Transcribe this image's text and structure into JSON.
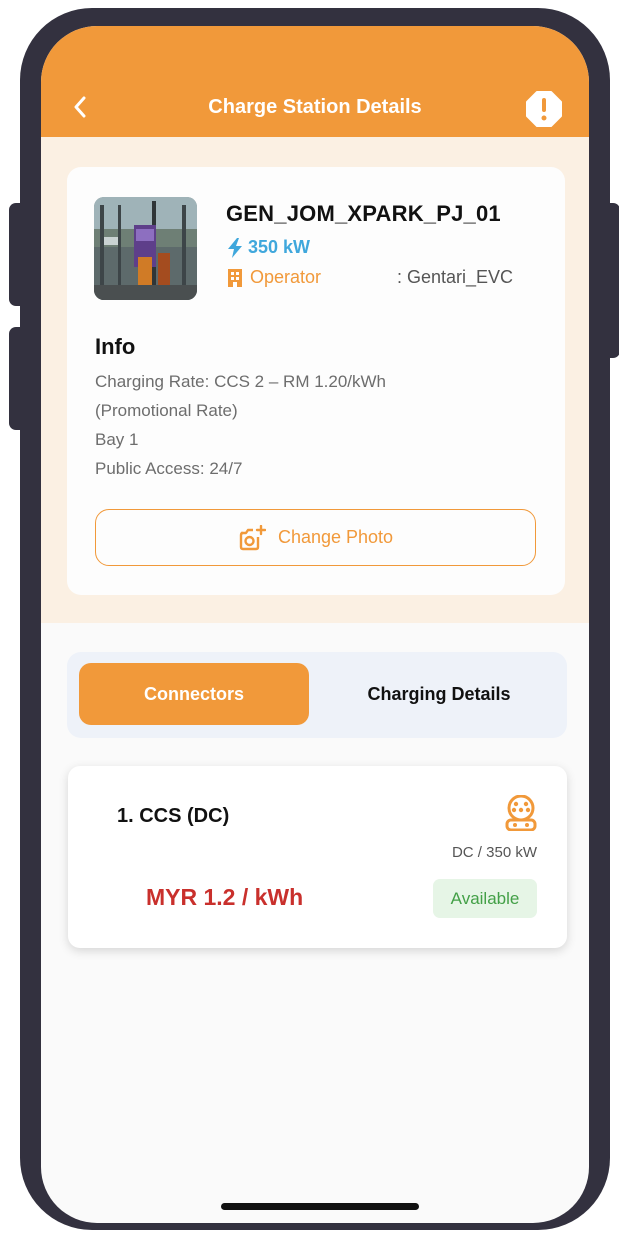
{
  "header": {
    "title": "Charge Station Details",
    "back_icon": "chevron-left-icon",
    "alert_icon": "alert-octagon-icon"
  },
  "station": {
    "name": "GEN_JOM_XPARK_PJ_01",
    "power": "350 kW",
    "operator_label": "Operator",
    "operator_value": ": Gentari_EVC"
  },
  "info": {
    "title": "Info",
    "lines": [
      "Charging Rate: CCS 2 – RM 1.20/kWh",
      "(Promotional Rate)",
      "Bay 1",
      "Public Access: 24/7"
    ]
  },
  "change_photo_label": "Change Photo",
  "tabs": [
    {
      "label": "Connectors",
      "active": true
    },
    {
      "label": "Charging Details",
      "active": false
    }
  ],
  "connectors": [
    {
      "name": "1.  CCS (DC)",
      "spec": "DC / 350 kW",
      "price": "MYR 1.2 / kWh",
      "status": "Available",
      "icon": "ccs-plug-icon"
    }
  ],
  "colors": {
    "accent": "#f1993a",
    "power": "#3fa7dc",
    "price": "#c9302c",
    "available_text": "#43a047",
    "available_bg": "#e6f5e6",
    "frame": "#33313f"
  }
}
